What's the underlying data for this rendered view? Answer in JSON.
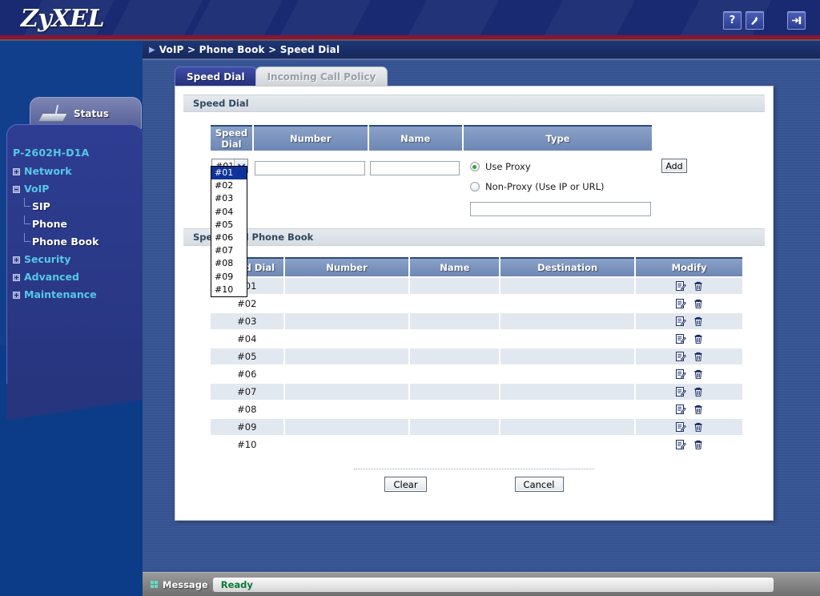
{
  "header": {
    "logo": "ZyXEL",
    "icons": [
      {
        "name": "help-icon",
        "glyph": "?"
      },
      {
        "name": "wizard-icon",
        "glyph": "✦"
      },
      {
        "name": "logout-icon",
        "glyph": "⇥"
      }
    ]
  },
  "sidebar": {
    "status_label": "Status",
    "model": "P-2602H-D1A",
    "items": [
      {
        "label": "Network",
        "expander": "plus",
        "level": 0
      },
      {
        "label": "VoIP",
        "expander": "minus",
        "level": 0
      },
      {
        "label": "SIP",
        "expander": "none",
        "level": 1
      },
      {
        "label": "Phone",
        "expander": "none",
        "level": 1
      },
      {
        "label": "Phone Book",
        "expander": "none",
        "level": 1
      },
      {
        "label": "Security",
        "expander": "plus",
        "level": 0
      },
      {
        "label": "Advanced",
        "expander": "plus",
        "level": 0
      },
      {
        "label": "Maintenance",
        "expander": "plus",
        "level": 0
      }
    ]
  },
  "breadcrumb": "VoIP > Phone Book > Speed Dial",
  "tabs": [
    {
      "label": "Speed Dial",
      "active": true
    },
    {
      "label": "Incoming Call Policy",
      "active": false
    }
  ],
  "form_section": {
    "title": "Speed Dial",
    "columns": [
      "Speed Dial",
      "Number",
      "Name",
      "Type"
    ],
    "speed_dial_select": {
      "value": "#01",
      "open": true,
      "options": [
        "#01",
        "#02",
        "#03",
        "#04",
        "#05",
        "#06",
        "#07",
        "#08",
        "#09",
        "#10"
      ],
      "highlighted": "#01"
    },
    "number_value": "",
    "number_placeholder": "",
    "name_value": "",
    "name_placeholder": "",
    "type_options": [
      {
        "label": "Use Proxy",
        "selected": true
      },
      {
        "label": "Non-Proxy (Use IP or URL)",
        "selected": false
      }
    ],
    "nonproxy_value": "",
    "nonproxy_placeholder": "",
    "add_label": "Add"
  },
  "phonebook_section": {
    "title": "Speed Dial Phone Book",
    "columns": [
      "Speed Dial",
      "Number",
      "Name",
      "Destination",
      "Modify"
    ],
    "rows": [
      {
        "speed_dial": "#01",
        "number": "",
        "name": "",
        "destination": ""
      },
      {
        "speed_dial": "#02",
        "number": "",
        "name": "",
        "destination": ""
      },
      {
        "speed_dial": "#03",
        "number": "",
        "name": "",
        "destination": ""
      },
      {
        "speed_dial": "#04",
        "number": "",
        "name": "",
        "destination": ""
      },
      {
        "speed_dial": "#05",
        "number": "",
        "name": "",
        "destination": ""
      },
      {
        "speed_dial": "#06",
        "number": "",
        "name": "",
        "destination": ""
      },
      {
        "speed_dial": "#07",
        "number": "",
        "name": "",
        "destination": ""
      },
      {
        "speed_dial": "#08",
        "number": "",
        "name": "",
        "destination": ""
      },
      {
        "speed_dial": "#09",
        "number": "",
        "name": "",
        "destination": ""
      },
      {
        "speed_dial": "#10",
        "number": "",
        "name": "",
        "destination": ""
      }
    ],
    "modify_icons": [
      "edit-icon",
      "delete-icon"
    ]
  },
  "footer_buttons": [
    {
      "label": "Clear",
      "name": "clear-button"
    },
    {
      "label": "Cancel",
      "name": "cancel-button"
    }
  ],
  "statusbar": {
    "label": "Message",
    "message": "Ready"
  },
  "colors": {
    "brand_blue": "#1a2a72",
    "accent_red": "#8c1430",
    "nav_cyan": "#56c8e8",
    "table_header": "#6d87b4",
    "row_shade": "#e2e8ef",
    "ready_green": "#0a7a3c",
    "radio_green": "#3a9b3a",
    "dropdown_highlight": "#10339b"
  }
}
